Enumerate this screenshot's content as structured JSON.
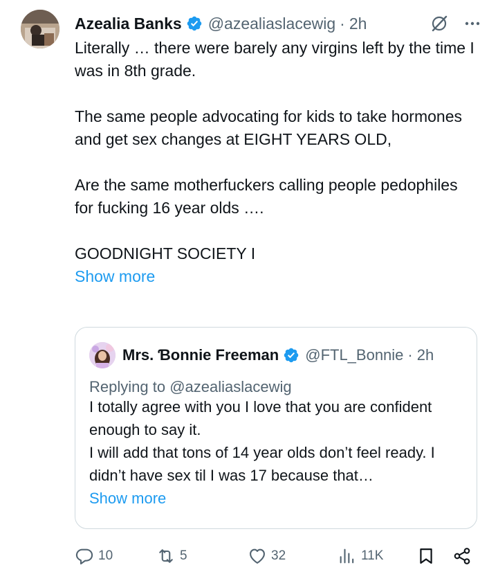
{
  "tweet": {
    "author_name": "Azealia Banks",
    "author_handle": "@azealiaslacewig",
    "separator": "·",
    "time": "2h",
    "paragraphs": [
      "Literally … there were barely any virgins left by the time I was in 8th grade.",
      "The same people advocating for kids to take hormones and get sex changes at EIGHT YEARS OLD,",
      "Are the same motherfuckers calling people pedophiles for fucking 16 year olds ….",
      "GOODNIGHT SOCIETY I"
    ],
    "show_more": "Show more"
  },
  "quote": {
    "author_name": "Mrs. Ɓonnie Freeman",
    "author_handle": "@FTL_Bonnie",
    "separator": "·",
    "time": "2h",
    "replying_prefix": "Replying to ",
    "replying_to": "@azealiaslacewig",
    "lines": [
      "I totally agree with you I love that you are confident enough to say it.",
      "I will add that tons of 14 year olds don’t feel ready. I didn’t have sex til I was 17 because that…"
    ],
    "show_more": "Show more"
  },
  "actions": {
    "replies": "10",
    "reposts": "5",
    "likes": "32",
    "views": "11K"
  },
  "colors": {
    "text": "#0f1419",
    "secondary": "#536471",
    "link": "#1d9bf0",
    "verified": "#1d9bf0",
    "border": "#cfd9de"
  },
  "icons": [
    "verified-badge-icon",
    "grok-icon",
    "more-icon",
    "reply-icon",
    "repost-icon",
    "like-icon",
    "views-icon",
    "bookmark-icon",
    "share-icon"
  ]
}
